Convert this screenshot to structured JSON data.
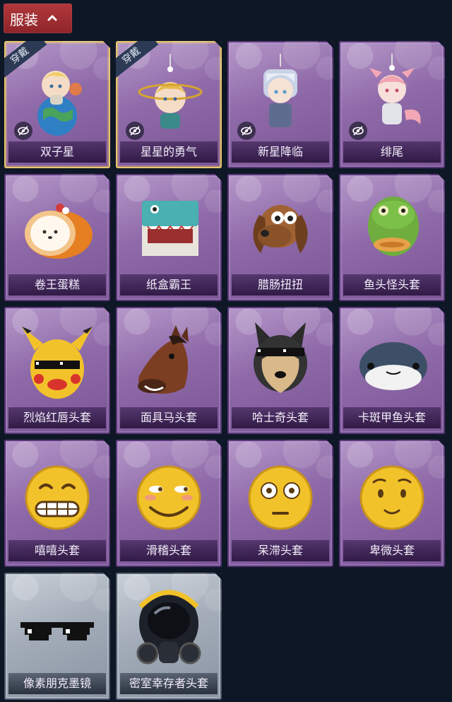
{
  "header": {
    "title": "服装"
  },
  "badge_label": "穿戴",
  "items": [
    {
      "name": "双子星",
      "art": "plush-boy-on-globe",
      "equipped": true,
      "frame": "purple"
    },
    {
      "name": "星星的勇气",
      "art": "plush-boy-with-planet-ring",
      "equipped": true,
      "frame": "purple"
    },
    {
      "name": "新星降临",
      "art": "silver-haired-figure-charm",
      "equipped": false,
      "frame": "purple"
    },
    {
      "name": "绯尾",
      "art": "pink-fox-girl-charm",
      "equipped": false,
      "frame": "purple"
    },
    {
      "name": "卷王蛋糕",
      "art": "roll-cake",
      "equipped": false,
      "frame": "purple"
    },
    {
      "name": "纸盒霸王",
      "art": "cardboard-dinosaur-head",
      "equipped": false,
      "frame": "purple"
    },
    {
      "name": "腊肠扭扭",
      "art": "dachshund-head",
      "equipped": false,
      "frame": "purple"
    },
    {
      "name": "鱼头怪头套",
      "art": "fish-head-mask",
      "equipped": false,
      "frame": "purple"
    },
    {
      "name": "烈焰红唇头套",
      "art": "yellow-mouse-mask-sunglasses",
      "equipped": false,
      "frame": "purple"
    },
    {
      "name": "面具马头套",
      "art": "horse-head-mask",
      "equipped": false,
      "frame": "purple"
    },
    {
      "name": "哈士奇头套",
      "art": "husky-head-sunglasses",
      "equipped": false,
      "frame": "purple"
    },
    {
      "name": "卡斑甲鱼头套",
      "art": "pufferfish-head",
      "equipped": false,
      "frame": "purple"
    },
    {
      "name": "嘻嘻头套",
      "art": "grinning-emoji-head",
      "equipped": false,
      "frame": "purple"
    },
    {
      "name": "滑稽头套",
      "art": "smirking-emoji-head",
      "equipped": false,
      "frame": "purple"
    },
    {
      "name": "呆滞头套",
      "art": "flushed-emoji-head",
      "equipped": false,
      "frame": "purple"
    },
    {
      "name": "卑微头套",
      "art": "pleading-emoji-head",
      "equipped": false,
      "frame": "purple"
    },
    {
      "name": "像素朋克墨镜",
      "art": "pixel-sunglasses",
      "equipped": false,
      "frame": "grey"
    },
    {
      "name": "密室幸存者头套",
      "art": "gas-mask-helmet",
      "equipped": false,
      "frame": "grey"
    }
  ]
}
